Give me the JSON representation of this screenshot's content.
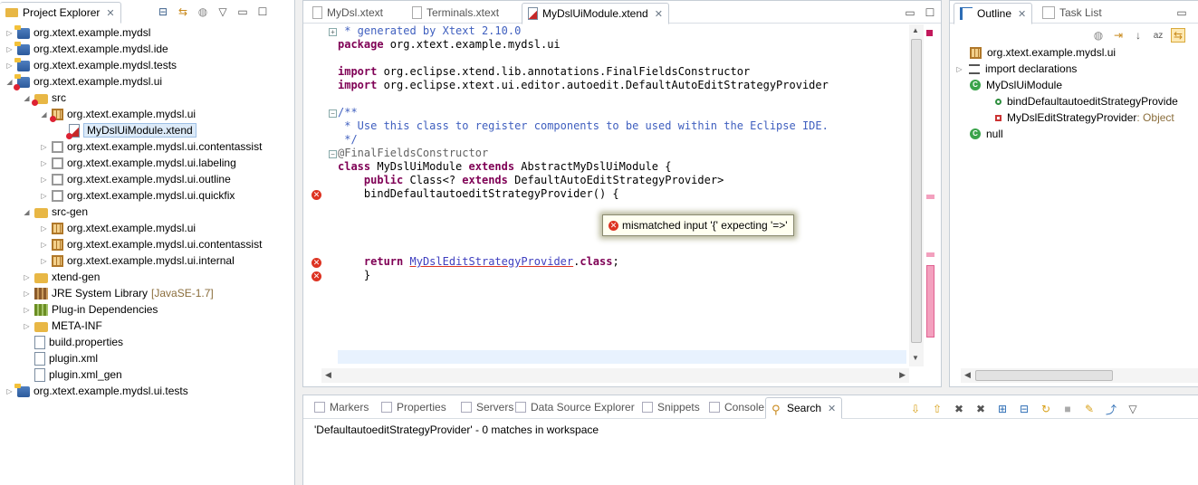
{
  "project_explorer": {
    "tab_label": "Project Explorer",
    "tree": [
      {
        "label": "org.xtext.example.mydsl",
        "kind": "proj",
        "err": false,
        "depth": 0,
        "twisty": "▷"
      },
      {
        "label": "org.xtext.example.mydsl.ide",
        "kind": "proj",
        "err": false,
        "depth": 0,
        "twisty": "▷"
      },
      {
        "label": "org.xtext.example.mydsl.tests",
        "kind": "proj",
        "err": false,
        "depth": 0,
        "twisty": "▷"
      },
      {
        "label": "org.xtext.example.mydsl.ui",
        "kind": "proj",
        "err": true,
        "depth": 0,
        "twisty": "◢"
      },
      {
        "label": "src",
        "kind": "folder",
        "err": true,
        "depth": 1,
        "twisty": "◢"
      },
      {
        "label": "org.xtext.example.mydsl.ui",
        "kind": "pkg",
        "err": true,
        "depth": 2,
        "twisty": "◢"
      },
      {
        "label": "MyDslUiModule.xtend",
        "kind": "xtend",
        "err": true,
        "depth": 3,
        "twisty": "",
        "selected": true
      },
      {
        "label": "org.xtext.example.mydsl.ui.contentassist",
        "kind": "pkg-empty",
        "err": false,
        "depth": 2,
        "twisty": "▷"
      },
      {
        "label": "org.xtext.example.mydsl.ui.labeling",
        "kind": "pkg-empty",
        "err": false,
        "depth": 2,
        "twisty": "▷"
      },
      {
        "label": "org.xtext.example.mydsl.ui.outline",
        "kind": "pkg-empty",
        "err": false,
        "depth": 2,
        "twisty": "▷"
      },
      {
        "label": "org.xtext.example.mydsl.ui.quickfix",
        "kind": "pkg-empty",
        "err": false,
        "depth": 2,
        "twisty": "▷"
      },
      {
        "label": "src-gen",
        "kind": "folder",
        "err": false,
        "depth": 1,
        "twisty": "◢"
      },
      {
        "label": "org.xtext.example.mydsl.ui",
        "kind": "pkg",
        "err": false,
        "depth": 2,
        "twisty": "▷"
      },
      {
        "label": "org.xtext.example.mydsl.ui.contentassist",
        "kind": "pkg",
        "err": false,
        "depth": 2,
        "twisty": "▷"
      },
      {
        "label": "org.xtext.example.mydsl.ui.internal",
        "kind": "pkg",
        "err": false,
        "depth": 2,
        "twisty": "▷"
      },
      {
        "label": "xtend-gen",
        "kind": "folder",
        "err": false,
        "depth": 1,
        "twisty": "▷"
      },
      {
        "label": "JRE System Library",
        "suffix": "[JavaSE-1.7]",
        "kind": "lib",
        "err": false,
        "depth": 1,
        "twisty": "▷"
      },
      {
        "label": "Plug-in Dependencies",
        "kind": "dep",
        "err": false,
        "depth": 1,
        "twisty": "▷"
      },
      {
        "label": "META-INF",
        "kind": "folder",
        "err": false,
        "depth": 1,
        "twisty": "▷"
      },
      {
        "label": "build.properties",
        "kind": "file",
        "err": false,
        "depth": 1,
        "twisty": ""
      },
      {
        "label": "plugin.xml",
        "kind": "file",
        "err": false,
        "depth": 1,
        "twisty": ""
      },
      {
        "label": "plugin.xml_gen",
        "kind": "file",
        "err": false,
        "depth": 1,
        "twisty": ""
      },
      {
        "label": "org.xtext.example.mydsl.ui.tests",
        "kind": "proj",
        "err": false,
        "depth": 0,
        "twisty": "▷"
      }
    ]
  },
  "editor": {
    "tabs": [
      "MyDsl.xtext",
      "Terminals.xtext",
      "MyDslUiModule.xtend"
    ],
    "active_tab": 2,
    "code_lines": [
      [
        {
          "t": " * generated by ",
          "c": "jd"
        },
        {
          "t": "Xtext",
          "c": "jd"
        },
        {
          "t": " 2.10.0",
          "c": "jd"
        }
      ],
      [
        {
          "t": "package",
          "c": "kw"
        },
        {
          "t": " org.xtext.example.mydsl.ui",
          "c": ""
        }
      ],
      [],
      [
        {
          "t": "import",
          "c": "kw"
        },
        {
          "t": " org.eclipse.xtend.lib.annotations.FinalFieldsConstructor",
          "c": ""
        }
      ],
      [
        {
          "t": "import",
          "c": "kw"
        },
        {
          "t": " org.eclipse.xtext.ui.editor.autoedit.DefaultAutoEditStrategyProvider",
          "c": ""
        }
      ],
      [],
      [
        {
          "t": "/**",
          "c": "jd"
        }
      ],
      [
        {
          "t": " * Use this class to register components to be used within the Eclipse IDE.",
          "c": "jd"
        }
      ],
      [
        {
          "t": " */",
          "c": "jd"
        }
      ],
      [
        {
          "t": "@FinalFieldsConstructor",
          "c": "an"
        }
      ],
      [
        {
          "t": "class",
          "c": "kw"
        },
        {
          "t": " MyDslUiModule ",
          "c": ""
        },
        {
          "t": "extends",
          "c": "kw"
        },
        {
          "t": " AbstractMyDslUiModule {",
          "c": ""
        }
      ],
      [
        {
          "t": "    ",
          "c": ""
        },
        {
          "t": "public",
          "c": "kw"
        },
        {
          "t": " Class<? ",
          "c": ""
        },
        {
          "t": "extends",
          "c": "kw"
        },
        {
          "t": " DefaultAutoEditStrategyProvider>",
          "c": ""
        }
      ],
      [
        {
          "t": "    bindDefaultautoeditStrategyProvider() {",
          "c": ""
        }
      ],
      [],
      [],
      [],
      [],
      [
        {
          "t": "    ",
          "c": ""
        },
        {
          "t": "return",
          "c": "kw"
        },
        {
          "t": " ",
          "c": ""
        },
        {
          "t": "MyDslEditStrategyProvider",
          "c": "link"
        },
        {
          "t": ".",
          "c": ""
        },
        {
          "t": "class",
          "c": "kw"
        },
        {
          "t": ";",
          "c": ""
        }
      ],
      [
        {
          "t": "    }",
          "c": ""
        }
      ]
    ],
    "tooltip": "mismatched input '{' expecting '=>'"
  },
  "outline": {
    "tabs": [
      "Outline",
      "Task List"
    ],
    "items": [
      {
        "label": "org.xtext.example.mydsl.ui",
        "kind": "pkg",
        "depth": 0
      },
      {
        "label": "import declarations",
        "kind": "imports",
        "depth": 0
      },
      {
        "label": "MyDslUiModule",
        "kind": "class",
        "depth": 0
      },
      {
        "label": "bindDefaultautoeditStrategyProvide",
        "kind": "method",
        "depth": 1
      },
      {
        "label": "MyDslEditStrategyProvider",
        "suffix": " : Object",
        "kind": "field",
        "depth": 1
      },
      {
        "label": "null",
        "kind": "class",
        "depth": 0
      }
    ]
  },
  "bottom": {
    "tabs": [
      "Markers",
      "Properties",
      "Servers",
      "Data Source Explorer",
      "Snippets",
      "Console",
      "Search"
    ],
    "active_tab": 6,
    "result": "'DefaultautoeditStrategyProvider' - 0 matches in workspace"
  },
  "colors": {
    "keyword": "#7f0055",
    "javadoc": "#3f5fbf",
    "annotation": "#646464",
    "error": "#dd3322",
    "selection": "#dceaf8"
  }
}
